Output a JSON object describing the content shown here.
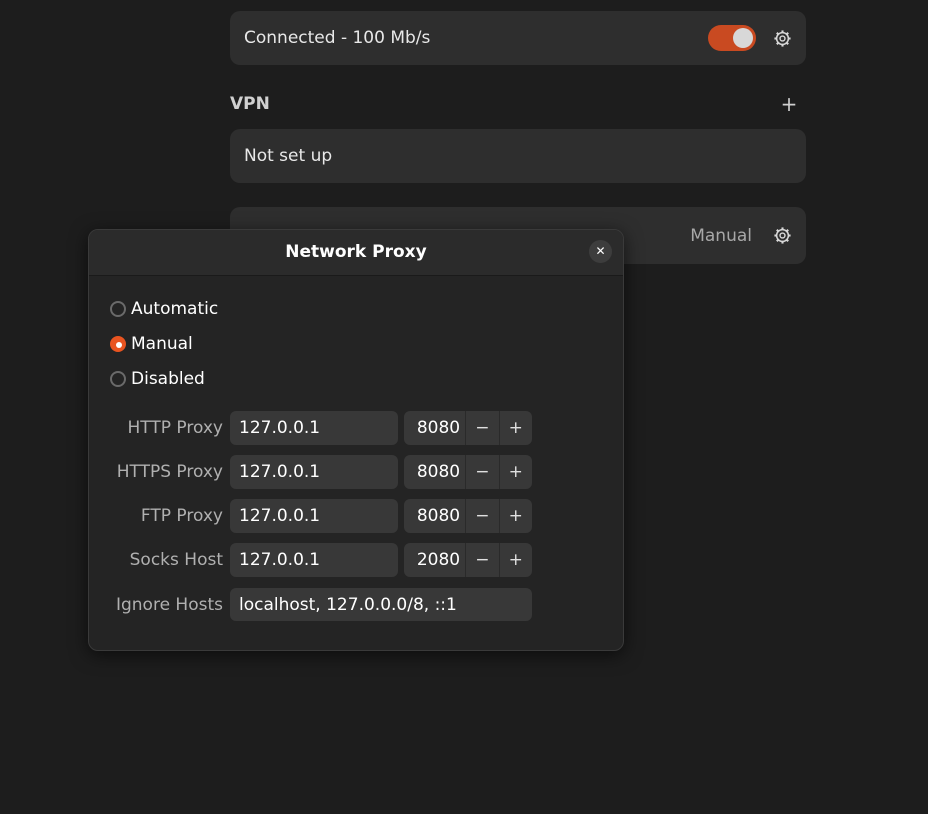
{
  "background": {
    "wired": {
      "label": "Connected - 100 Mb/s",
      "enabled": true
    },
    "vpn": {
      "title": "VPN",
      "add_label": "+",
      "status": "Not set up"
    },
    "proxy": {
      "value": "Manual"
    }
  },
  "dialog": {
    "title": "Network Proxy",
    "close_label": "✕",
    "options": [
      {
        "label": "Automatic",
        "checked": false
      },
      {
        "label": "Manual",
        "checked": true
      },
      {
        "label": "Disabled",
        "checked": false
      }
    ],
    "fields": [
      {
        "label": "HTTP Proxy",
        "host": "127.0.0.1",
        "port": "8080"
      },
      {
        "label": "HTTPS Proxy",
        "host": "127.0.0.1",
        "port": "8080"
      },
      {
        "label": "FTP Proxy",
        "host": "127.0.0.1",
        "port": "8080"
      },
      {
        "label": "Socks Host",
        "host": "127.0.0.1",
        "port": "2080"
      }
    ],
    "ignore_hosts": {
      "label": "Ignore Hosts",
      "value": "localhost, 127.0.0.0/8, ::1"
    },
    "spin_minus": "−",
    "spin_plus": "+"
  },
  "colors": {
    "accent": "#e95420",
    "toggle_on": "#c94a21"
  }
}
